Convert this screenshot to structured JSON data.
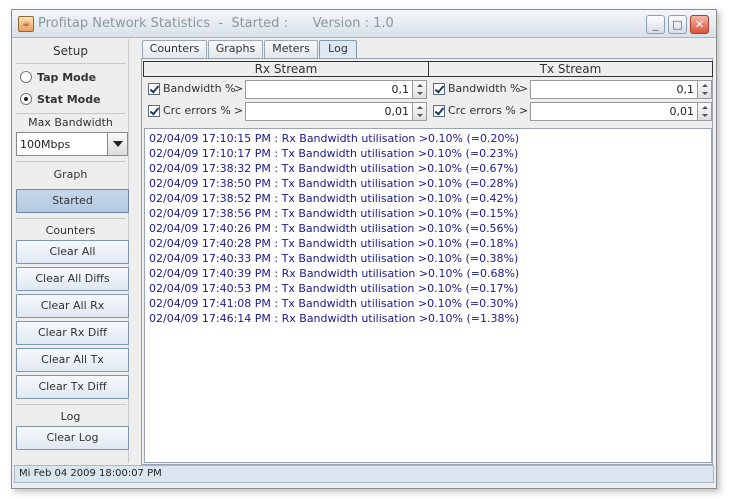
{
  "window": {
    "title": "Profitap Network Statistics  -  Started :      Version : 1.0",
    "icon": "java-cup-icon",
    "controls": [
      "minimize",
      "maximize",
      "close"
    ]
  },
  "left_panel": {
    "setup_label": "Setup",
    "modes": [
      {
        "label": "Tap Mode",
        "selected": false
      },
      {
        "label": "Stat Mode",
        "selected": true
      }
    ],
    "max_bandwidth_label": "Max Bandwidth",
    "max_bandwidth_value": "100Mbps",
    "graph_label": "Graph",
    "graph_button": "Started",
    "counters_label": "Counters",
    "counter_buttons": [
      "Clear All",
      "Clear All Diffs",
      "Clear All Rx",
      "Clear Rx Diff",
      "Clear All Tx",
      "Clear Tx Diff"
    ],
    "log_label": "Log",
    "log_button": "Clear Log"
  },
  "tabs": [
    {
      "label": "Counters",
      "active": false
    },
    {
      "label": "Graphs",
      "active": false
    },
    {
      "label": "Meters",
      "active": false
    },
    {
      "label": "Log",
      "active": true
    }
  ],
  "thresholds": {
    "rx_header": "Rx Stream",
    "tx_header": "Tx Stream",
    "rows": [
      {
        "label": "Bandwidth %",
        "op": ">",
        "rx_value": "0,1",
        "tx_value": "0,1",
        "checked": true
      },
      {
        "label": "Crc errors %",
        "op": ">",
        "rx_value": "0,01",
        "tx_value": "0,01",
        "checked": true
      }
    ]
  },
  "log": {
    "text_color": "#1a1a8c",
    "lines": [
      "02/04/09 17:10:15 PM : Rx Bandwidth utilisation >0.10% (=0.20%)",
      "02/04/09 17:10:17 PM : Tx Bandwidth utilisation >0.10% (=0.23%)",
      "02/04/09 17:38:32 PM : Tx Bandwidth utilisation >0.10% (=0.67%)",
      "02/04/09 17:38:50 PM : Tx Bandwidth utilisation >0.10% (=0.28%)",
      "02/04/09 17:38:52 PM : Tx Bandwidth utilisation >0.10% (=0.42%)",
      "02/04/09 17:38:56 PM : Tx Bandwidth utilisation >0.10% (=0.15%)",
      "02/04/09 17:40:26 PM : Tx Bandwidth utilisation >0.10% (=0.56%)",
      "02/04/09 17:40:28 PM : Tx Bandwidth utilisation >0.10% (=0.18%)",
      "02/04/09 17:40:33 PM : Tx Bandwidth utilisation >0.10% (=0.38%)",
      "02/04/09 17:40:39 PM : Rx Bandwidth utilisation >0.10% (=0.68%)",
      "02/04/09 17:40:53 PM : Tx Bandwidth utilisation >0.10% (=0.17%)",
      "02/04/09 17:41:08 PM : Tx Bandwidth utilisation >0.10% (=0.30%)",
      "02/04/09 17:46:14 PM : Rx Bandwidth utilisation >0.10% (=1.38%)"
    ]
  },
  "status_bar": {
    "text": "Mi Feb 04 2009 18:00:07 PM"
  }
}
